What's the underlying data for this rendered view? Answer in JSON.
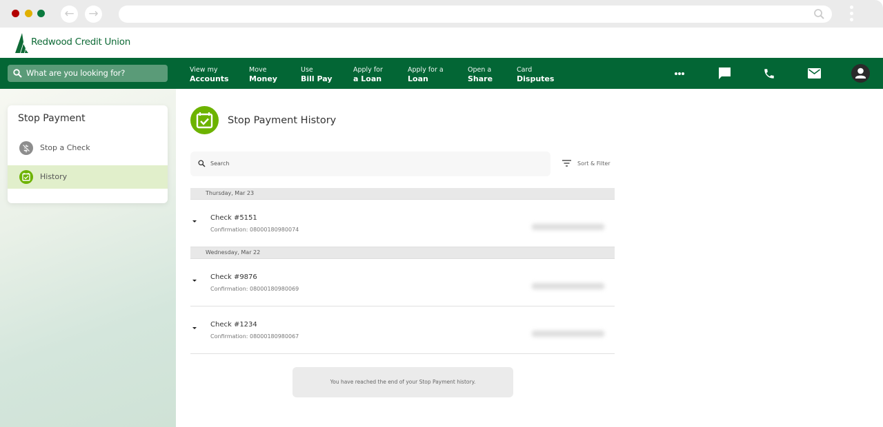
{
  "browser": {
    "traffic_lights": [
      "#b30000",
      "#e0b000",
      "#0a7a3e"
    ],
    "back_icon": "arrow-left-icon",
    "forward_icon": "arrow-right-icon",
    "url": "",
    "search_icon": "search-icon",
    "menu_icon": "kebab-icon"
  },
  "brand": {
    "name": "Redwood Credit Union",
    "color": "#036635",
    "accent": "#6db300"
  },
  "nav": {
    "search_placeholder": "What are you looking for?",
    "links": [
      {
        "small": "View my",
        "large": "Accounts"
      },
      {
        "small": "Move",
        "large": "Money"
      },
      {
        "small": "Use",
        "large": "Bill Pay"
      },
      {
        "small": "Apply for",
        "large": "a Loan"
      },
      {
        "small": "Apply for a",
        "large": "Loan"
      },
      {
        "small": "Open a",
        "large": "Share"
      },
      {
        "small": "Card",
        "large": "Disputes"
      }
    ],
    "icons": [
      "more-icon",
      "chat-icon",
      "phone-icon",
      "mail-icon",
      "profile-icon"
    ]
  },
  "sidebar": {
    "title": "Stop Payment",
    "items": [
      {
        "label": "Stop a Check",
        "icon": "stop-check-icon",
        "active": false
      },
      {
        "label": "History",
        "icon": "calendar-check-icon",
        "active": true
      }
    ]
  },
  "main": {
    "title": "Stop Payment History",
    "search_placeholder": "Search",
    "sort_filter_label": "Sort & Filter",
    "groups": [
      {
        "date": "Thursday, Mar 23",
        "items": [
          {
            "title": "Check #5151",
            "confirmation": "Confirmation: 08000180980074",
            "amount": "(blurred)"
          }
        ]
      },
      {
        "date": "Wednesday, Mar 22",
        "items": [
          {
            "title": "Check #9876",
            "confirmation": "Confirmation: 08000180980069",
            "amount": "(blurred)"
          },
          {
            "title": "Check #1234",
            "confirmation": "Confirmation: 08000180980067",
            "amount": "(blurred)"
          }
        ]
      }
    ],
    "end_message": "You have reached the end of your Stop Payment history."
  }
}
